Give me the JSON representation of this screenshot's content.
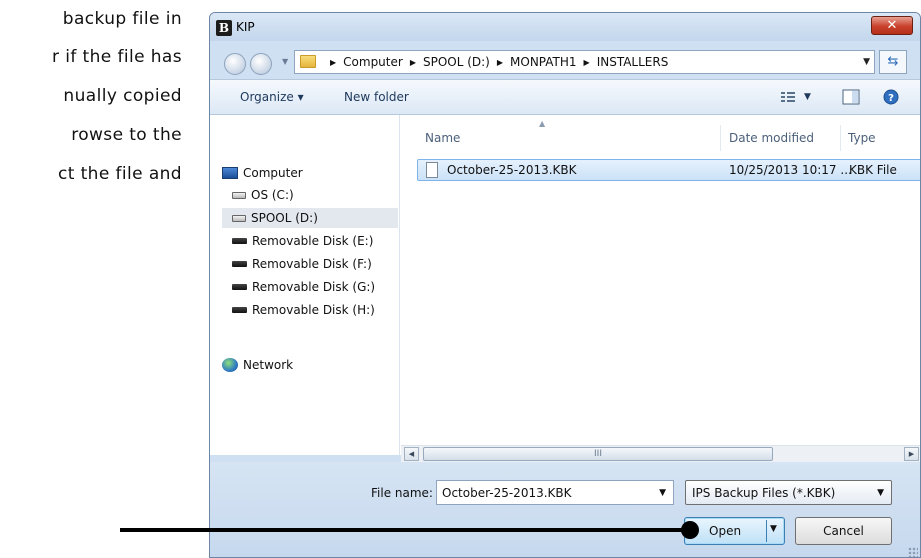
{
  "document": {
    "lines": [
      "backup file in",
      "r if the file has",
      "nually copied",
      "rowse to the",
      "ct the file and"
    ]
  },
  "dialog": {
    "title": "KIP",
    "app_icon_letter": "B",
    "close_glyph": "✕",
    "address": {
      "crumbs": [
        "Computer",
        "SPOOL (D:)",
        "MONPATH1",
        "INSTALLERS"
      ],
      "separator": "▶"
    },
    "toolbar": {
      "organize": "Organize ▾",
      "new_folder": "New folder",
      "view_icon": "view-options-icon",
      "preview_icon": "preview-pane-icon",
      "help_icon": "help-icon"
    },
    "nav": {
      "computer": "Computer",
      "drives": [
        {
          "label": "OS (C:)",
          "type": "hard-drive"
        },
        {
          "label": "SPOOL (D:)",
          "type": "hard-drive",
          "selected": true
        },
        {
          "label": "Removable Disk (E:)",
          "type": "removable"
        },
        {
          "label": "Removable Disk (F:)",
          "type": "removable"
        },
        {
          "label": "Removable Disk (G:)",
          "type": "removable"
        },
        {
          "label": "Removable Disk (H:)",
          "type": "removable"
        }
      ],
      "network": "Network"
    },
    "columns": {
      "name": "Name",
      "date": "Date modified",
      "type": "Type"
    },
    "files": [
      {
        "name": "October-25-2013.KBK",
        "date": "10/25/2013 10:17 ...",
        "type": "KBK File"
      }
    ],
    "scroll_thumb": "III",
    "file_name_label": "File name:",
    "file_name_value": "October-25-2013.KBK",
    "file_type_value": "IPS Backup Files (*.KBK)",
    "open_label": "Open",
    "cancel_label": "Cancel"
  },
  "colors": {
    "selection": "#cbe2f8",
    "close_button": "#c9412b",
    "frame": "#cfe0f2"
  }
}
